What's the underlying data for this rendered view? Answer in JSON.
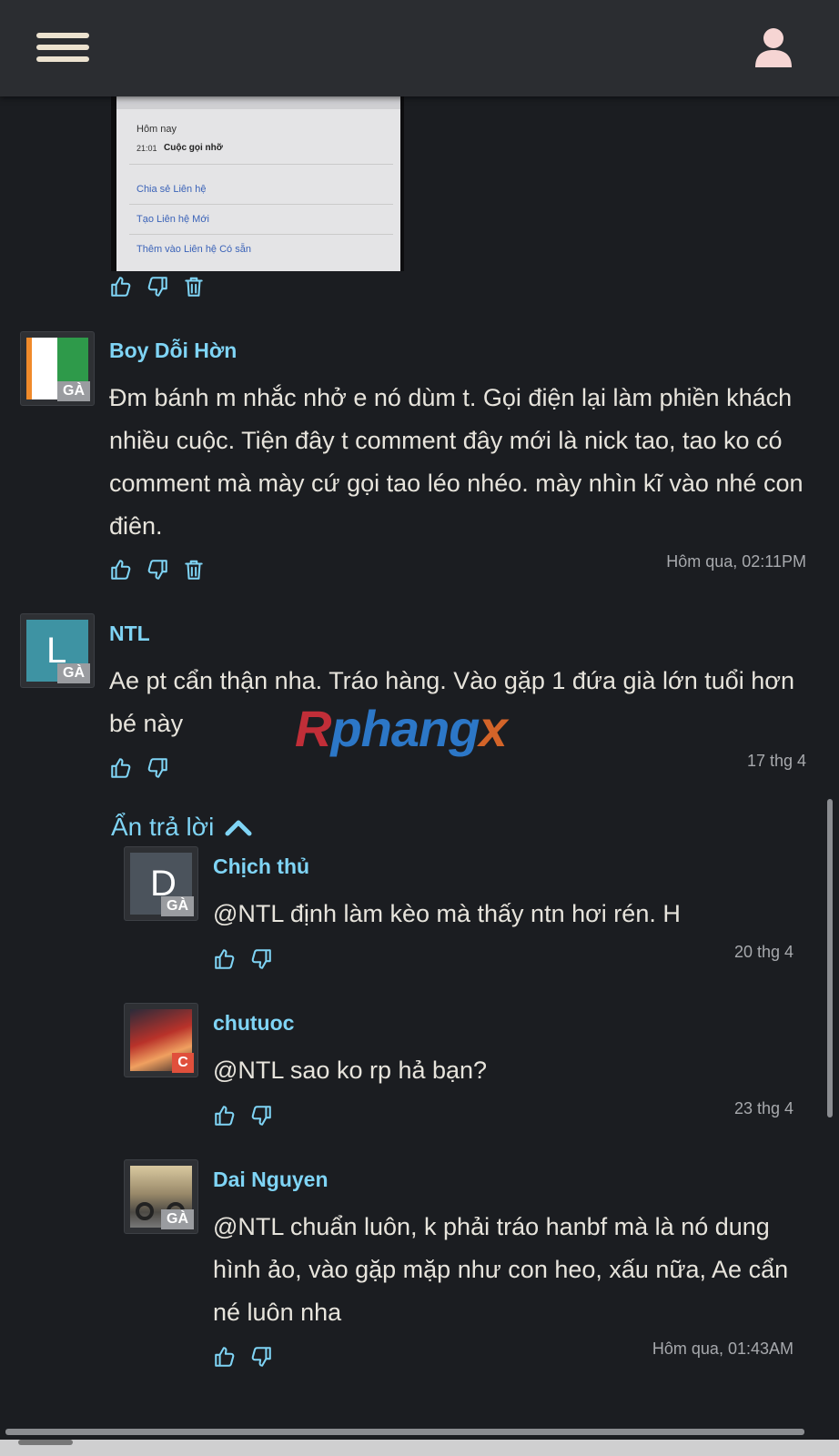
{
  "header": {
    "menu_icon": "hamburger-menu-icon",
    "user_icon": "user-icon"
  },
  "attached_image": {
    "lines": [
      "Hôm nay",
      "21:01",
      "Cuộc gọi nhỡ",
      "Chia sẻ Liên hệ",
      "Tạo Liên hệ Mới",
      "Thêm vào Liên hệ Có sẵn"
    ]
  },
  "watermark": {
    "part1": "R",
    "part2": "phang",
    "part3": "x"
  },
  "comments": [
    {
      "author": "Boy Dỗi Hờn",
      "badge": "GÀ",
      "text": "Đm bánh m nhắc nhở e nó dùm t. Gọi điện lại làm phiền khách nhiều cuộc. Tiện đây t comment đây mới là nick tao, tao ko có comment mà mày cứ gọi tao léo nhéo. mày nhìn kĩ vào nhé con điên.",
      "time": "Hôm qua, 02:11PM"
    },
    {
      "author": "NTL",
      "avatar_letter": "L",
      "badge": "GÀ",
      "text": "Ae pt cẩn thận nha. Tráo hàng. Vào gặp 1 đứa già lớn tuổi hơn bé này",
      "time": "17 thg 4"
    }
  ],
  "toggle_replies_label": "Ẩn trả lời",
  "replies": [
    {
      "author": "Chịch thủ",
      "avatar_letter": "D",
      "badge": "GÀ",
      "text": "@NTL định làm kèo mà thấy ntn hơi rén. H",
      "time": "20 thg 4"
    },
    {
      "author": "chutuoc",
      "badge": "C",
      "text": "@NTL sao ko rp hả bạn?",
      "time": "23 thg 4"
    },
    {
      "author": "Dai Nguyen",
      "badge": "GÀ",
      "text": "@NTL chuẩn luôn, k phải tráo hanbf mà là nó dung hình ảo, vào gặp mặp như con heo, xấu nữa, Ae cẩn né luôn nha",
      "time": "Hôm qua, 01:43AM"
    }
  ],
  "colors": {
    "background": "#1b1d21",
    "header": "#2b2d31",
    "accent": "#7fd4f5",
    "text": "#e7e4dc",
    "muted": "#a7a9ad"
  }
}
